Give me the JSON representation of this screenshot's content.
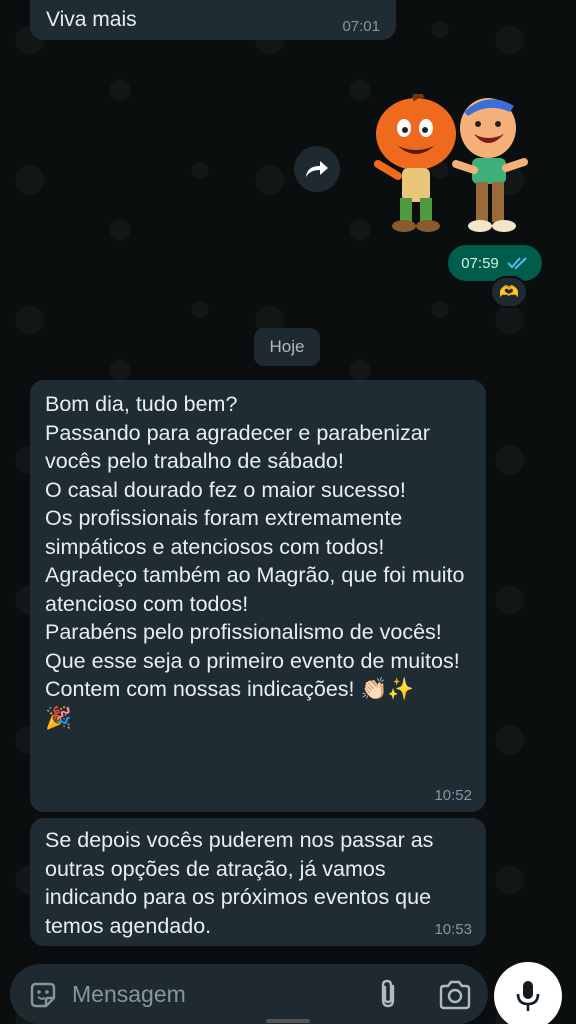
{
  "previous_message": {
    "text": "Viva mais",
    "time": "07:01"
  },
  "sticker": {
    "time": "07:59",
    "reaction": "🫶"
  },
  "date_separator": "Hoje",
  "messages": [
    {
      "text": "Bom dia, tudo bem?\nPassando para agradecer e parabenizar vocês pelo trabalho de sábado!\nO casal dourado fez o maior sucesso!\nOs profissionais foram extremamente simpáticos e atenciosos com todos!\nAgradeço também ao Magrão, que foi muito atencioso com todos!\nParabéns pelo profissionalismo de vocês!\nQue esse seja o primeiro evento de muitos!\nContem com nossas indicações! 👏🏻✨\n🎉",
      "time": "10:52"
    },
    {
      "text": "Se depois vocês puderem nos passar as outras opções de atração, já vamos indicando para os próximos eventos que temos agendado.",
      "time": "10:53"
    }
  ],
  "composer": {
    "placeholder": "Mensagem"
  },
  "icons": {
    "forward": "forward-icon",
    "read_receipt": "double-check-icon",
    "sticker": "sticker-icon",
    "attach": "paperclip-icon",
    "camera": "camera-icon",
    "mic": "microphone-icon"
  },
  "colors": {
    "background": "#0b0e0f",
    "incoming_bubble": "#202c33",
    "outgoing_bubble": "#005c4b",
    "read_tick": "#53bdeb"
  }
}
